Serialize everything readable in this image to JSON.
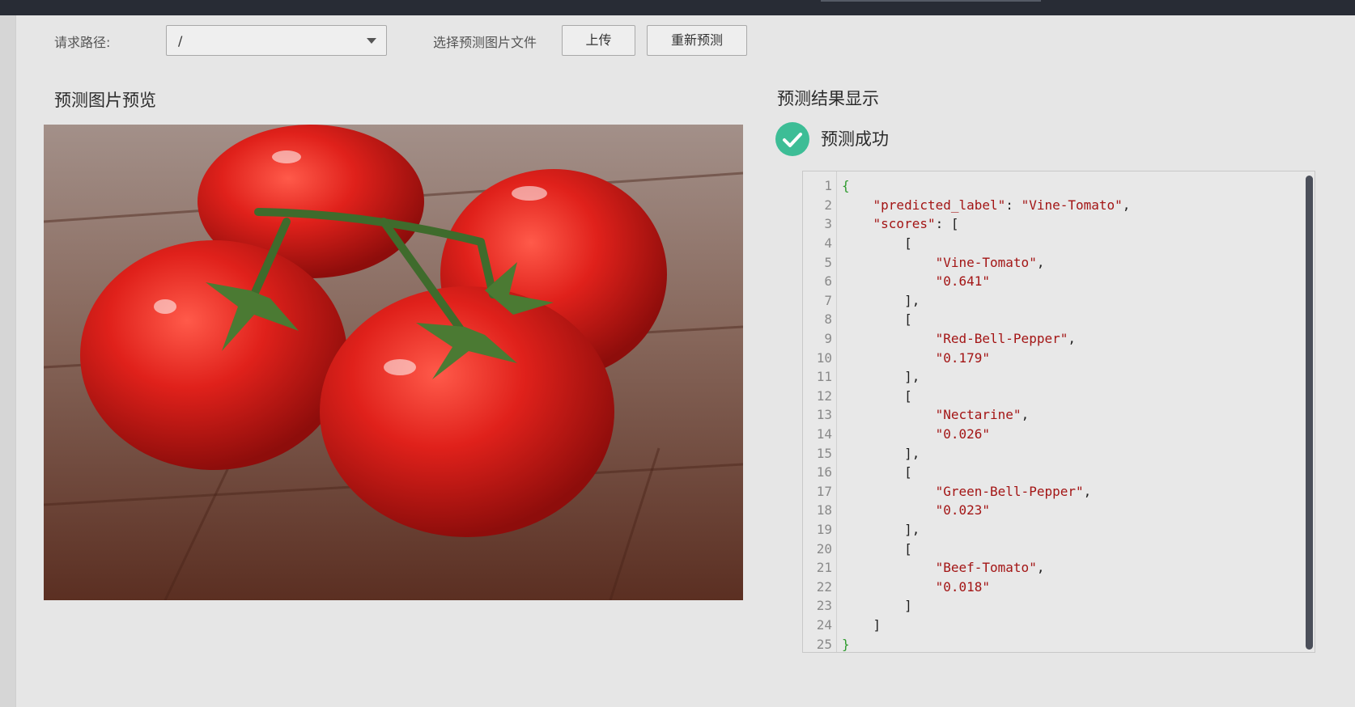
{
  "toolbar": {
    "path_label": "请求路径:",
    "path_value": "/",
    "file_label": "选择预测图片文件",
    "upload_label": "上传",
    "repredict_label": "重新预测"
  },
  "preview": {
    "title": "预测图片预览"
  },
  "result": {
    "title": "预测结果显示",
    "status_text": "预测成功",
    "status_icon": "check-circle-icon",
    "status_color": "#3dbd96",
    "code_lines": [
      {
        "ln": "1",
        "text": "{"
      },
      {
        "ln": "2",
        "text": "    \"predicted_label\": \"Vine-Tomato\","
      },
      {
        "ln": "3",
        "text": "    \"scores\": ["
      },
      {
        "ln": "4",
        "text": "        ["
      },
      {
        "ln": "5",
        "text": "            \"Vine-Tomato\","
      },
      {
        "ln": "6",
        "text": "            \"0.641\""
      },
      {
        "ln": "7",
        "text": "        ],"
      },
      {
        "ln": "8",
        "text": "        ["
      },
      {
        "ln": "9",
        "text": "            \"Red-Bell-Pepper\","
      },
      {
        "ln": "10",
        "text": "            \"0.179\""
      },
      {
        "ln": "11",
        "text": "        ],"
      },
      {
        "ln": "12",
        "text": "        ["
      },
      {
        "ln": "13",
        "text": "            \"Nectarine\","
      },
      {
        "ln": "14",
        "text": "            \"0.026\""
      },
      {
        "ln": "15",
        "text": "        ],"
      },
      {
        "ln": "16",
        "text": "        ["
      },
      {
        "ln": "17",
        "text": "            \"Green-Bell-Pepper\","
      },
      {
        "ln": "18",
        "text": "            \"0.023\""
      },
      {
        "ln": "19",
        "text": "        ],"
      },
      {
        "ln": "20",
        "text": "        ["
      },
      {
        "ln": "21",
        "text": "            \"Beef-Tomato\","
      },
      {
        "ln": "22",
        "text": "            \"0.018\""
      },
      {
        "ln": "23",
        "text": "        ]"
      },
      {
        "ln": "24",
        "text": "    ]"
      },
      {
        "ln": "25",
        "text": "}"
      }
    ]
  },
  "colors": {
    "string": "#a31515",
    "brace": "#2e9b2e",
    "background": "#e6e6e6",
    "topbar": "#282c35"
  }
}
